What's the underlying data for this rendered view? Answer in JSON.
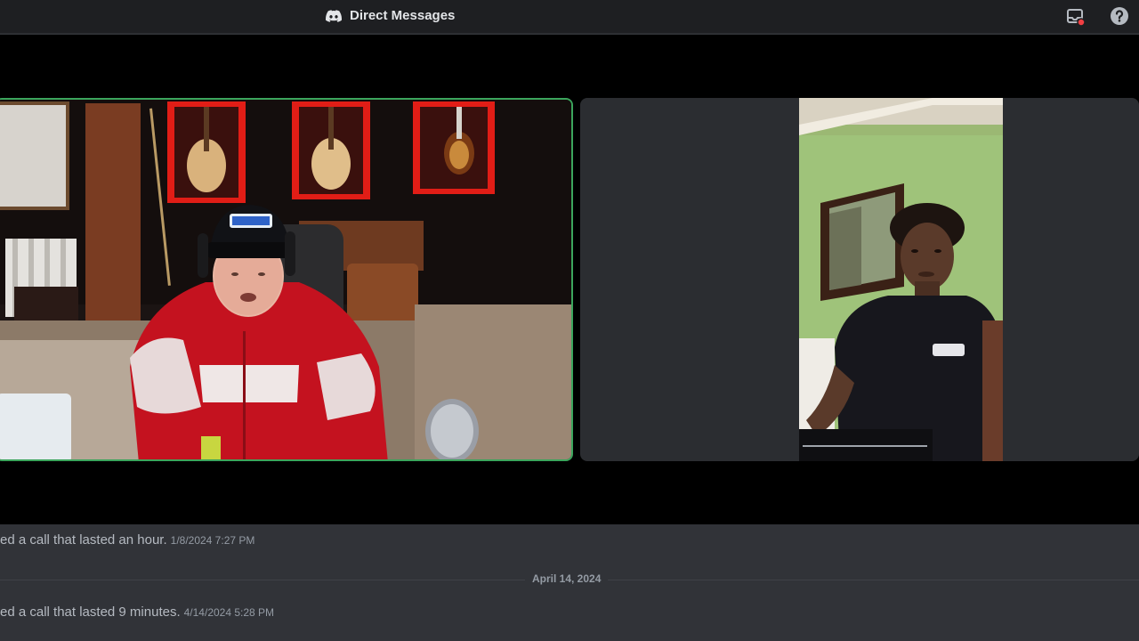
{
  "titlebar": {
    "title": "Direct Messages",
    "icons": [
      "discord-logo-icon",
      "inbox-icon",
      "help-icon"
    ]
  },
  "call": {
    "participants": [
      {
        "position": "left",
        "speaking": true,
        "video": "webcam feed: person in red hoodie and black cap wearing headphones in music studio with guitars on wall"
      },
      {
        "position": "right",
        "speaking": false,
        "video": "webcam feed: person in black t-shirt in room with green wall and mirror"
      }
    ],
    "speaking_color": "#3ba55c"
  },
  "chat": {
    "messages": [
      {
        "text": "ed a call that lasted an hour.",
        "timestamp": "1/8/2024 7:27 PM"
      },
      {
        "text": "ed a call that lasted 9 minutes.",
        "timestamp": "4/14/2024 5:28 PM"
      }
    ],
    "date_divider": "April 14, 2024"
  }
}
